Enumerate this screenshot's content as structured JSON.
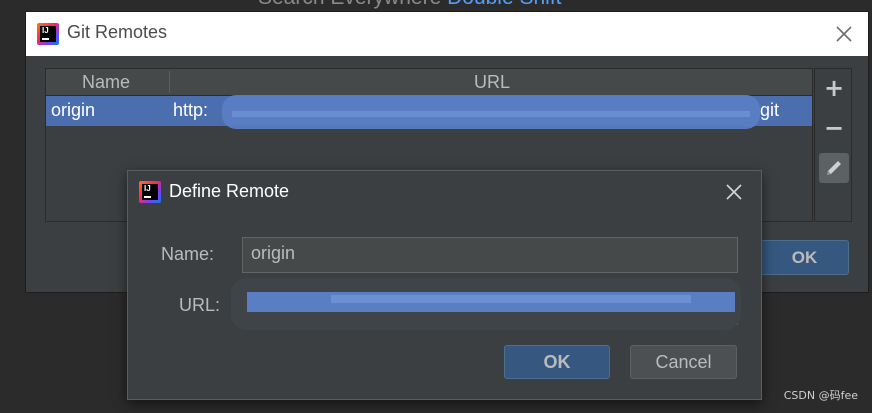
{
  "background_hint": {
    "prefix": "Search Everywhere",
    "shortcut": "Double Shift"
  },
  "git_remotes_window": {
    "title": "Git Remotes",
    "table": {
      "columns": [
        "Name",
        "URL"
      ],
      "rows": [
        {
          "name": "origin",
          "url_prefix": "http:",
          "url_suffix": "git",
          "selected": true
        }
      ]
    },
    "toolbar": {
      "add_icon": "+",
      "remove_icon": "−",
      "edit_icon": "pencil-icon"
    },
    "ok_label": "OK"
  },
  "define_remote_dialog": {
    "title": "Define Remote",
    "name_label": "Name:",
    "name_value": "origin",
    "url_label": "URL:",
    "ok_label": "OK",
    "cancel_label": "Cancel"
  },
  "watermark": "CSDN @码fee",
  "colors": {
    "selection": "#4b6eaf",
    "accent": "#589df6",
    "button_default": "#365880"
  }
}
